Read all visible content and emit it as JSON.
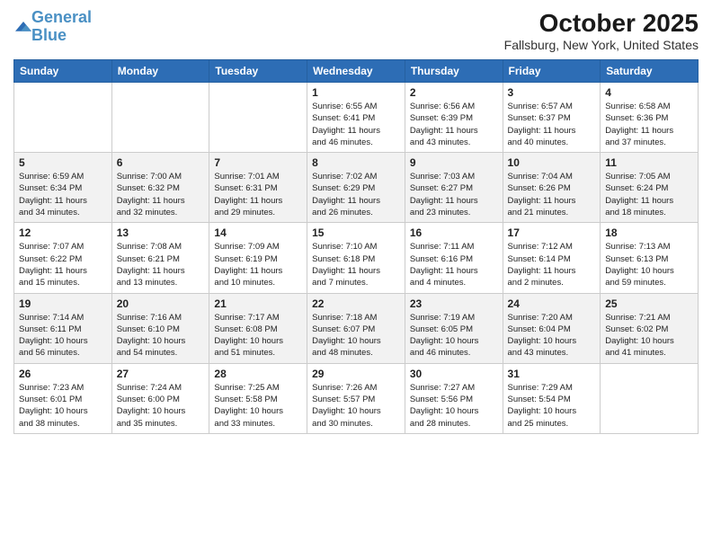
{
  "header": {
    "logo_line1": "General",
    "logo_line2": "Blue",
    "month_title": "October 2025",
    "location": "Fallsburg, New York, United States"
  },
  "days_of_week": [
    "Sunday",
    "Monday",
    "Tuesday",
    "Wednesday",
    "Thursday",
    "Friday",
    "Saturday"
  ],
  "weeks": [
    [
      {
        "day": "",
        "info": ""
      },
      {
        "day": "",
        "info": ""
      },
      {
        "day": "",
        "info": ""
      },
      {
        "day": "1",
        "info": "Sunrise: 6:55 AM\nSunset: 6:41 PM\nDaylight: 11 hours\nand 46 minutes."
      },
      {
        "day": "2",
        "info": "Sunrise: 6:56 AM\nSunset: 6:39 PM\nDaylight: 11 hours\nand 43 minutes."
      },
      {
        "day": "3",
        "info": "Sunrise: 6:57 AM\nSunset: 6:37 PM\nDaylight: 11 hours\nand 40 minutes."
      },
      {
        "day": "4",
        "info": "Sunrise: 6:58 AM\nSunset: 6:36 PM\nDaylight: 11 hours\nand 37 minutes."
      }
    ],
    [
      {
        "day": "5",
        "info": "Sunrise: 6:59 AM\nSunset: 6:34 PM\nDaylight: 11 hours\nand 34 minutes."
      },
      {
        "day": "6",
        "info": "Sunrise: 7:00 AM\nSunset: 6:32 PM\nDaylight: 11 hours\nand 32 minutes."
      },
      {
        "day": "7",
        "info": "Sunrise: 7:01 AM\nSunset: 6:31 PM\nDaylight: 11 hours\nand 29 minutes."
      },
      {
        "day": "8",
        "info": "Sunrise: 7:02 AM\nSunset: 6:29 PM\nDaylight: 11 hours\nand 26 minutes."
      },
      {
        "day": "9",
        "info": "Sunrise: 7:03 AM\nSunset: 6:27 PM\nDaylight: 11 hours\nand 23 minutes."
      },
      {
        "day": "10",
        "info": "Sunrise: 7:04 AM\nSunset: 6:26 PM\nDaylight: 11 hours\nand 21 minutes."
      },
      {
        "day": "11",
        "info": "Sunrise: 7:05 AM\nSunset: 6:24 PM\nDaylight: 11 hours\nand 18 minutes."
      }
    ],
    [
      {
        "day": "12",
        "info": "Sunrise: 7:07 AM\nSunset: 6:22 PM\nDaylight: 11 hours\nand 15 minutes."
      },
      {
        "day": "13",
        "info": "Sunrise: 7:08 AM\nSunset: 6:21 PM\nDaylight: 11 hours\nand 13 minutes."
      },
      {
        "day": "14",
        "info": "Sunrise: 7:09 AM\nSunset: 6:19 PM\nDaylight: 11 hours\nand 10 minutes."
      },
      {
        "day": "15",
        "info": "Sunrise: 7:10 AM\nSunset: 6:18 PM\nDaylight: 11 hours\nand 7 minutes."
      },
      {
        "day": "16",
        "info": "Sunrise: 7:11 AM\nSunset: 6:16 PM\nDaylight: 11 hours\nand 4 minutes."
      },
      {
        "day": "17",
        "info": "Sunrise: 7:12 AM\nSunset: 6:14 PM\nDaylight: 11 hours\nand 2 minutes."
      },
      {
        "day": "18",
        "info": "Sunrise: 7:13 AM\nSunset: 6:13 PM\nDaylight: 10 hours\nand 59 minutes."
      }
    ],
    [
      {
        "day": "19",
        "info": "Sunrise: 7:14 AM\nSunset: 6:11 PM\nDaylight: 10 hours\nand 56 minutes."
      },
      {
        "day": "20",
        "info": "Sunrise: 7:16 AM\nSunset: 6:10 PM\nDaylight: 10 hours\nand 54 minutes."
      },
      {
        "day": "21",
        "info": "Sunrise: 7:17 AM\nSunset: 6:08 PM\nDaylight: 10 hours\nand 51 minutes."
      },
      {
        "day": "22",
        "info": "Sunrise: 7:18 AM\nSunset: 6:07 PM\nDaylight: 10 hours\nand 48 minutes."
      },
      {
        "day": "23",
        "info": "Sunrise: 7:19 AM\nSunset: 6:05 PM\nDaylight: 10 hours\nand 46 minutes."
      },
      {
        "day": "24",
        "info": "Sunrise: 7:20 AM\nSunset: 6:04 PM\nDaylight: 10 hours\nand 43 minutes."
      },
      {
        "day": "25",
        "info": "Sunrise: 7:21 AM\nSunset: 6:02 PM\nDaylight: 10 hours\nand 41 minutes."
      }
    ],
    [
      {
        "day": "26",
        "info": "Sunrise: 7:23 AM\nSunset: 6:01 PM\nDaylight: 10 hours\nand 38 minutes."
      },
      {
        "day": "27",
        "info": "Sunrise: 7:24 AM\nSunset: 6:00 PM\nDaylight: 10 hours\nand 35 minutes."
      },
      {
        "day": "28",
        "info": "Sunrise: 7:25 AM\nSunset: 5:58 PM\nDaylight: 10 hours\nand 33 minutes."
      },
      {
        "day": "29",
        "info": "Sunrise: 7:26 AM\nSunset: 5:57 PM\nDaylight: 10 hours\nand 30 minutes."
      },
      {
        "day": "30",
        "info": "Sunrise: 7:27 AM\nSunset: 5:56 PM\nDaylight: 10 hours\nand 28 minutes."
      },
      {
        "day": "31",
        "info": "Sunrise: 7:29 AM\nSunset: 5:54 PM\nDaylight: 10 hours\nand 25 minutes."
      },
      {
        "day": "",
        "info": ""
      }
    ]
  ]
}
